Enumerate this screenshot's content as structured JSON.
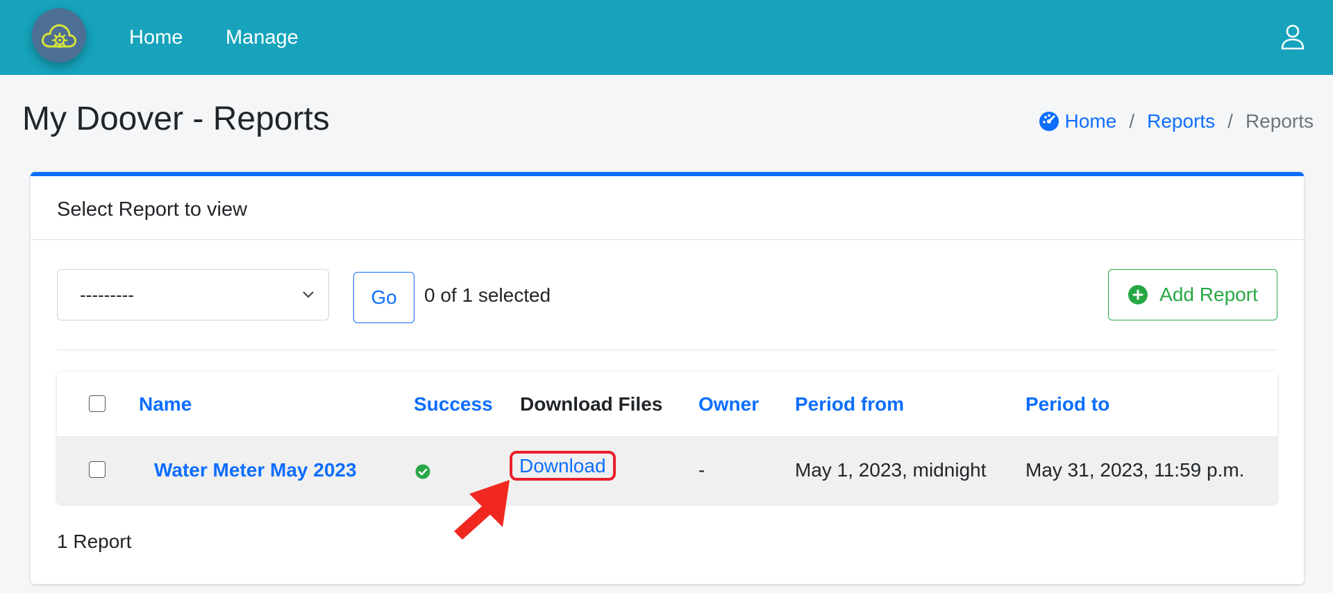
{
  "navbar": {
    "links": [
      "Home",
      "Manage"
    ],
    "brand_color": "#16a3bb"
  },
  "page": {
    "title": "My Doover - Reports"
  },
  "breadcrumb": {
    "items": [
      "Home",
      "Reports",
      "Reports"
    ],
    "separator": "/"
  },
  "card": {
    "header": "Select Report to view",
    "action_select_value": "---------",
    "go_label": "Go",
    "selected_count": "0 of 1 selected",
    "add_report_label": "Add Report",
    "report_count": "1 Report"
  },
  "table": {
    "columns": [
      "Name",
      "Success",
      "Download Files",
      "Owner",
      "Period from",
      "Period to"
    ],
    "rows": [
      {
        "name": "Water Meter May 2023",
        "success_icon": "check-circle-icon",
        "download": "Download",
        "owner": "-",
        "period_from": "May 1, 2023, midnight",
        "period_to": "May 31, 2023, 11:59 p.m."
      }
    ]
  },
  "colors": {
    "link": "#0d6efd",
    "success": "#28a745",
    "highlight": "#e8202a"
  }
}
